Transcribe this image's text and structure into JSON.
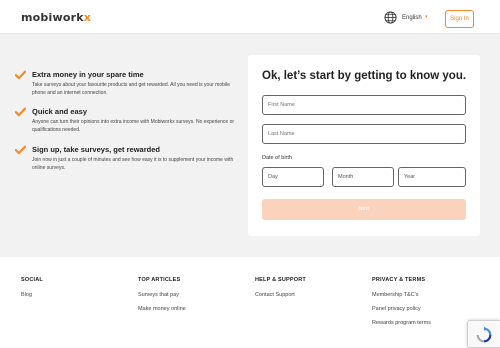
{
  "header": {
    "logo_main": "mobiwork",
    "logo_accent": "x",
    "language_icon": "globe-icon",
    "language": "English",
    "signin_label": "Sign In"
  },
  "benefits": [
    {
      "icon": "checkmark-icon",
      "title": "Extra money in your spare time",
      "text": "Take surveys about your favourite products and get rewarded. All you need is your mobile phone and an internet connection."
    },
    {
      "icon": "checkmark-icon",
      "title": "Quick and easy",
      "text": "Anyone can turn their opinions into extra income with Mobiworkx surveys. No experience or qualifications needed."
    },
    {
      "icon": "checkmark-icon",
      "title": "Sign up, take surveys, get rewarded",
      "text": "Join now in just a couple of minutes and see how easy it is to supplement your income with online surveys."
    }
  ],
  "form": {
    "title": "Ok, let’s start by getting to know you.",
    "first_name_placeholder": "First Name",
    "last_name_placeholder": "Last Name",
    "dob_label": "Date of birth",
    "day_label": "Day",
    "month_label": "Month",
    "year_label": "Year",
    "next_label": "Next"
  },
  "footer": {
    "social": {
      "heading": "SOCIAL",
      "links": [
        "Blog"
      ]
    },
    "articles": {
      "heading": "TOP ARTICLES",
      "links": [
        "Surveys that pay",
        "Make money online"
      ]
    },
    "help": {
      "heading": "HELP & SUPPORT",
      "links": [
        "Contact Support"
      ]
    },
    "privacy": {
      "heading": "PRIVACY & TERMS",
      "links": [
        "Membership T&C's",
        "Panel privacy policy",
        "Rewards program terms"
      ]
    }
  },
  "colors": {
    "accent": "#f28c28",
    "button_disabled": "#fbd3bd",
    "page_bg": "#f2f2f2"
  }
}
